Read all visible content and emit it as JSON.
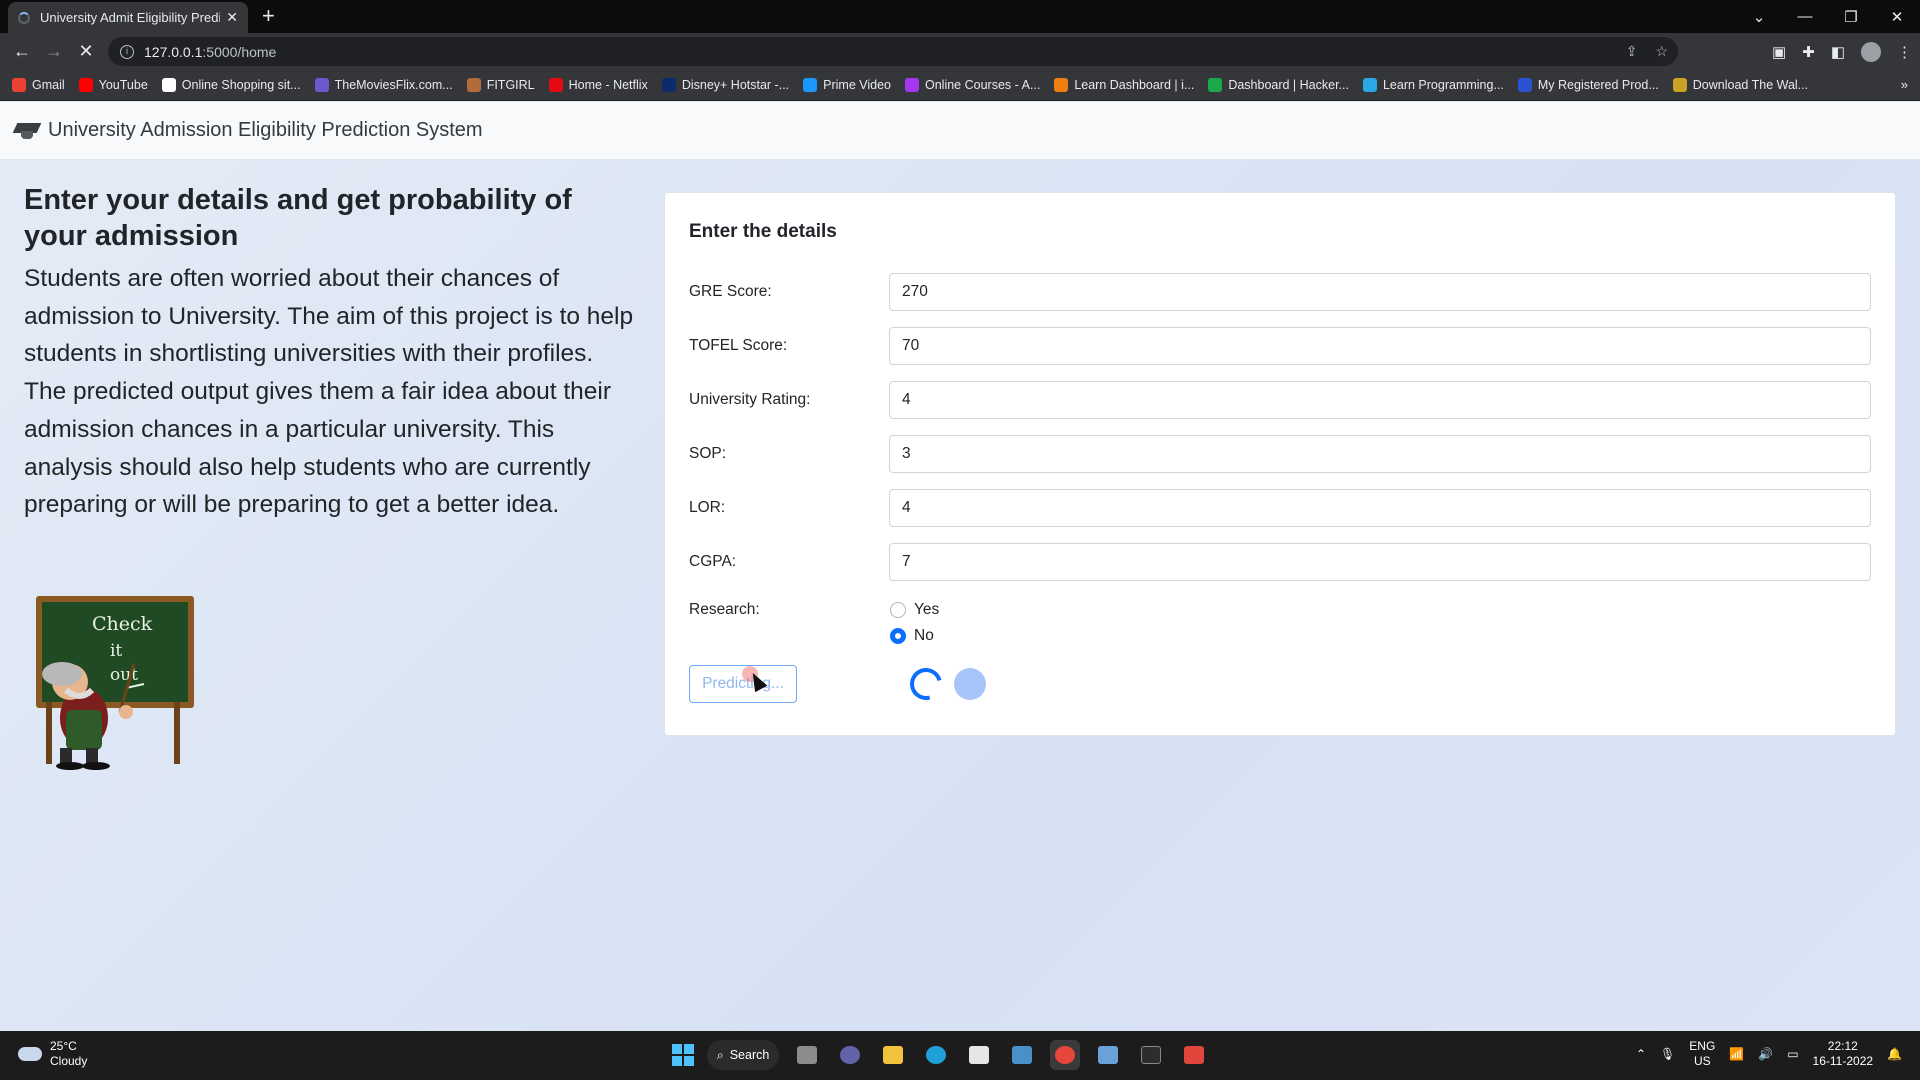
{
  "browser": {
    "tab_title": "University Admit Eligibility Predic",
    "url_host": "127.0.0.1",
    "url_path": ":5000/home",
    "bookmarks": [
      {
        "label": "Gmail",
        "color": "#ea4335"
      },
      {
        "label": "YouTube",
        "color": "#ff0000"
      },
      {
        "label": "Online Shopping sit...",
        "color": "#ffffff"
      },
      {
        "label": "TheMoviesFlix.com...",
        "color": "#6a5acd"
      },
      {
        "label": "FITGIRL",
        "color": "#b36b3c"
      },
      {
        "label": "Home - Netflix",
        "color": "#e50914"
      },
      {
        "label": "Disney+ Hotstar -...",
        "color": "#0c2b6b"
      },
      {
        "label": "Prime Video",
        "color": "#1a98ff"
      },
      {
        "label": "Online Courses - A...",
        "color": "#a435f0"
      },
      {
        "label": "Learn Dashboard | i...",
        "color": "#f07f13"
      },
      {
        "label": "Dashboard | Hacker...",
        "color": "#1ba94c"
      },
      {
        "label": "Learn Programming...",
        "color": "#2aa7e5"
      },
      {
        "label": "My Registered Prod...",
        "color": "#2b52d0"
      },
      {
        "label": "Download The Wal...",
        "color": "#c9a227"
      }
    ]
  },
  "app": {
    "brand": "University Admission Eligibility Prediction System",
    "heading": "Enter your details and get probability of your admission",
    "description": "Students are often worried about their chances of admission to University. The aim of this project is to help students in shortlisting universities with their profiles. The predicted output gives them a fair idea about their admission chances in a particular university. This analysis should also help students who are currently preparing or will be preparing to get a better idea.",
    "blackboard_text": [
      "Check",
      "it",
      "out"
    ]
  },
  "form": {
    "title": "Enter the details",
    "fields": [
      {
        "label": "GRE Score:",
        "value": "270"
      },
      {
        "label": "TOFEL Score:",
        "value": "70"
      },
      {
        "label": "University Rating:",
        "value": "4"
      },
      {
        "label": "SOP:",
        "value": "3"
      },
      {
        "label": "LOR:",
        "value": "4"
      },
      {
        "label": "CGPA:",
        "value": "7"
      }
    ],
    "research_label": "Research:",
    "research_options": [
      "Yes",
      "No"
    ],
    "research_selected": "No",
    "button_label": "Predicting..."
  },
  "taskbar": {
    "temperature": "25°C",
    "weather": "Cloudy",
    "search_label": "Search",
    "lang": "ENG",
    "region": "US",
    "time": "22:12",
    "date": "16-11-2022"
  },
  "colors": {
    "primary": "#0d6efd",
    "page_bg": "#dbe5f4"
  }
}
